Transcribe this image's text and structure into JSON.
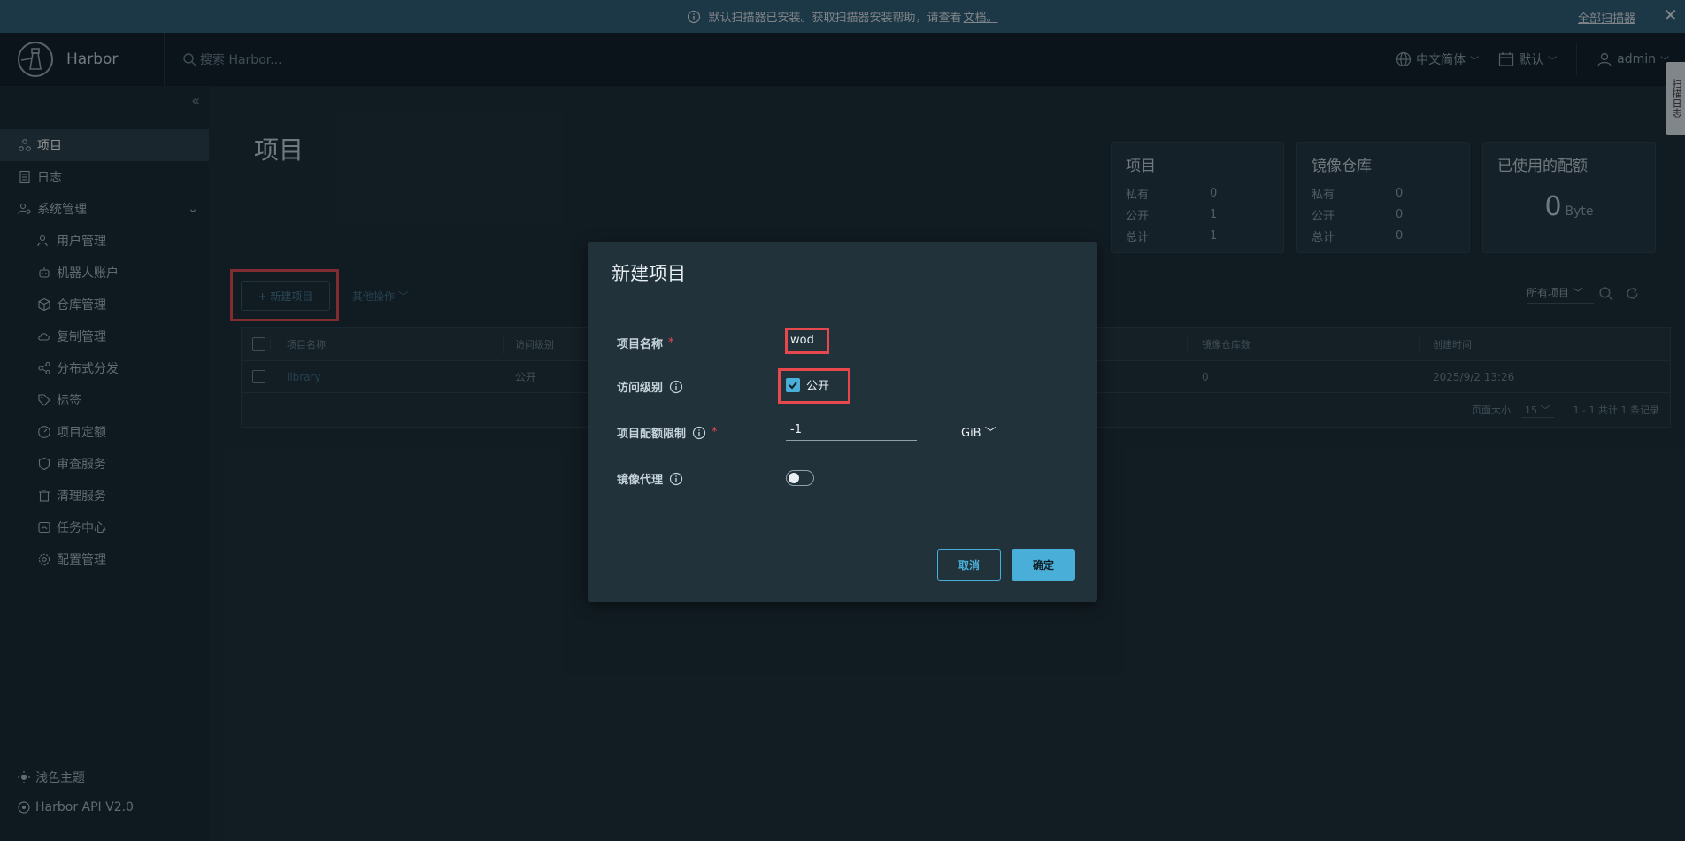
{
  "banner": {
    "message": "默认扫描器已安装。获取扫描器安装帮助，请查看",
    "link": "文档。",
    "right_link": "全部扫描器",
    "close": "✕"
  },
  "header": {
    "brand": "Harbor",
    "search_placeholder": "搜索 Harbor...",
    "language": "中文简体",
    "datetime_format": "默认",
    "user": "admin"
  },
  "side_tab": "扫描日志",
  "sidebar": {
    "items": [
      {
        "label": "项目"
      },
      {
        "label": "日志"
      },
      {
        "label": "系统管理"
      },
      {
        "label": "用户管理"
      },
      {
        "label": "机器人账户"
      },
      {
        "label": "仓库管理"
      },
      {
        "label": "复制管理"
      },
      {
        "label": "分布式分发"
      },
      {
        "label": "标签"
      },
      {
        "label": "项目定额"
      },
      {
        "label": "审查服务"
      },
      {
        "label": "清理服务"
      },
      {
        "label": "任务中心"
      },
      {
        "label": "配置管理"
      }
    ],
    "theme": "浅色主题",
    "api": "Harbor API V2.0"
  },
  "main": {
    "title": "项目",
    "cards": {
      "projects": {
        "title": "项目",
        "private_label": "私有",
        "private": "0",
        "public_label": "公开",
        "public": "1",
        "total_label": "总计",
        "total": "1"
      },
      "repos": {
        "title": "镜像仓库",
        "private_label": "私有",
        "private": "0",
        "public_label": "公开",
        "public": "0",
        "total_label": "总计",
        "total": "0"
      },
      "quota": {
        "title": "已使用的配额",
        "value": "0",
        "unit": "Byte"
      }
    },
    "new_project_label": "+ 新建项目",
    "other_ops_label": "其他操作",
    "filter_label": "所有项目",
    "table": {
      "headers": {
        "name": "项目名称",
        "access": "访问级别",
        "repo_count": "镜像仓库数",
        "created": "创建时间"
      },
      "rows": [
        {
          "name": "library",
          "access": "公开",
          "repo_count": "0",
          "created": "2025/9/2 13:26"
        }
      ],
      "page_size_label": "页面大小",
      "page_size": "15",
      "summary": "1 - 1 共计 1 条记录"
    }
  },
  "modal": {
    "title": "新建项目",
    "name_label": "项目名称",
    "name_value": "wod",
    "access_label": "访问级别",
    "public_label": "公开",
    "public_checked": true,
    "quota_label": "项目配额限制",
    "quota_value": "-1",
    "quota_unit": "GiB",
    "proxy_label": "镜像代理",
    "proxy_enabled": false,
    "cancel_label": "取消",
    "ok_label": "确定"
  },
  "colors": {
    "accent": "#49afd9",
    "highlight": "#e6484e",
    "banner": "#2f5d74",
    "header": "#0f1d24"
  }
}
